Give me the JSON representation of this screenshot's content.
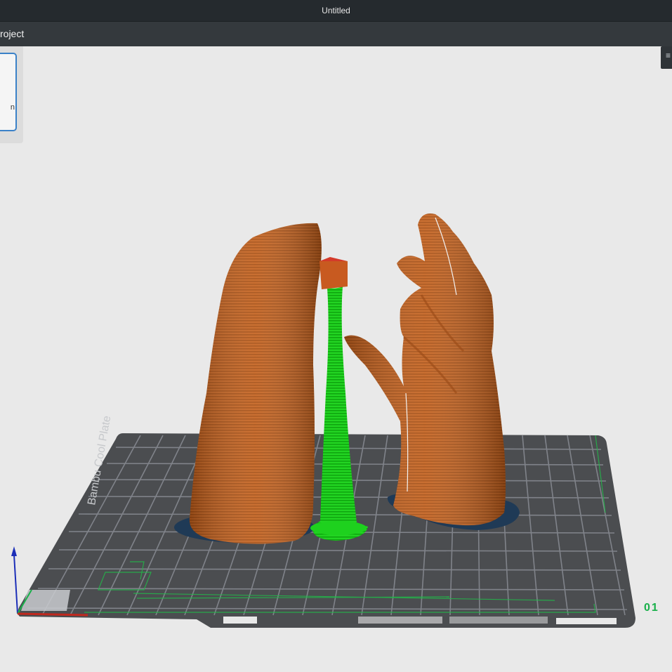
{
  "window": {
    "title": "Untitled"
  },
  "menubar": {
    "label": "roject"
  },
  "left_panel": {
    "text": "n"
  },
  "right_handle": {
    "glyph": "≡"
  },
  "plate": {
    "brand_text": "Bambu Cool Plate",
    "plate_number": "01"
  },
  "colors": {
    "object": "#c8621f",
    "support": "#1ed11e",
    "bed": "#4b4d50",
    "grid": "#7c7f82",
    "brim": "#1f3a56",
    "accent": "#18b04a"
  },
  "axes_icon": {
    "x": "red",
    "y": "green",
    "z": "blue"
  }
}
